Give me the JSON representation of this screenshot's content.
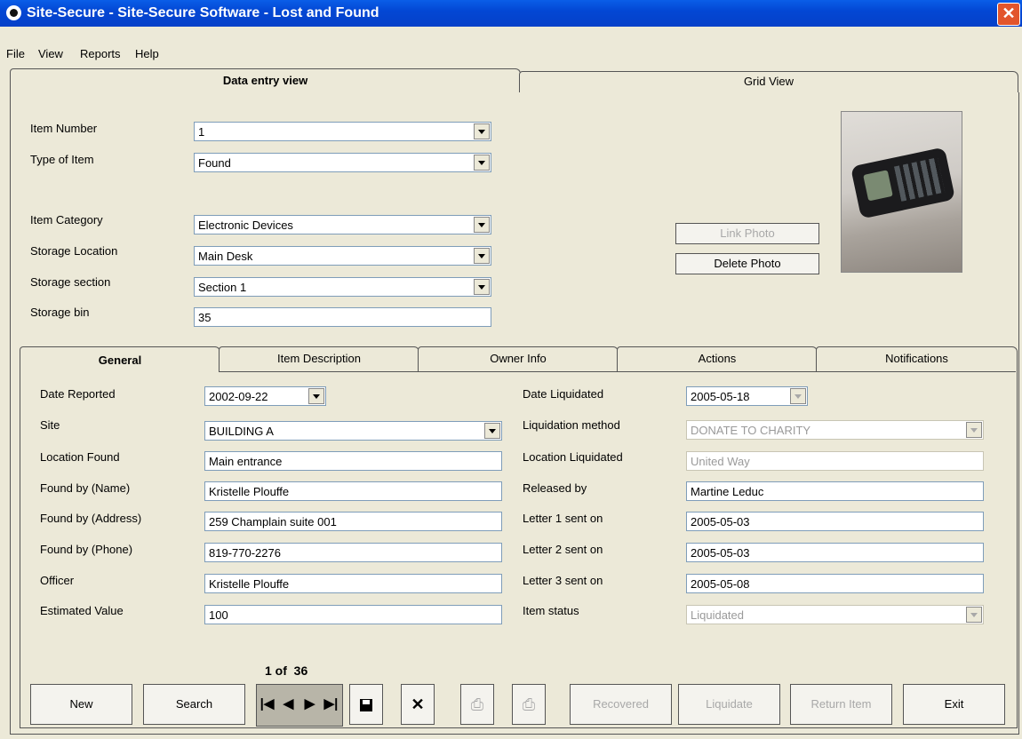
{
  "window": {
    "title": "Site-Secure - Site-Secure Software - Lost and Found",
    "close": "✕"
  },
  "menu": [
    "File",
    "View",
    "Reports",
    "Help"
  ],
  "main_tabs": [
    {
      "label": "Data entry view",
      "active": true
    },
    {
      "label": "Grid View",
      "active": false
    }
  ],
  "top_form": {
    "item_number": {
      "label": "Item Number",
      "value": "1"
    },
    "type_of_item": {
      "label": "Type of Item",
      "value": "Found"
    },
    "item_category": {
      "label": "Item Category",
      "value": "Electronic Devices"
    },
    "storage_location": {
      "label": "Storage Location",
      "value": "Main Desk"
    },
    "storage_section": {
      "label": "Storage section",
      "value": "Section 1"
    },
    "storage_bin": {
      "label": "Storage bin",
      "value": "35"
    }
  },
  "photo": {
    "link_label": "Link Photo",
    "delete_label": "Delete Photo"
  },
  "sub_tabs": [
    {
      "label": "General",
      "active": true
    },
    {
      "label": "Item Description",
      "active": false
    },
    {
      "label": "Owner Info",
      "active": false
    },
    {
      "label": "Actions",
      "active": false
    },
    {
      "label": "Notifications",
      "active": false
    }
  ],
  "general": {
    "date_reported": {
      "label": "Date Reported",
      "value": "2002-09-22"
    },
    "site": {
      "label": "Site",
      "value": "BUILDING A"
    },
    "location_found": {
      "label": "Location Found",
      "value": "Main entrance"
    },
    "found_by_name": {
      "label": "Found by (Name)",
      "value": "Kristelle Plouffe"
    },
    "found_by_address": {
      "label": "Found by (Address)",
      "value": "259 Champlain suite 001"
    },
    "found_by_phone": {
      "label": "Found by (Phone)",
      "value": "819-770-2276"
    },
    "officer": {
      "label": "Officer",
      "value": "Kristelle Plouffe"
    },
    "estimated_value": {
      "label": "Estimated Value",
      "value": "100"
    },
    "date_liquidated": {
      "label": "Date Liquidated",
      "value": "2005-05-18"
    },
    "liquidation_method": {
      "label": "Liquidation method",
      "value": "DONATE TO CHARITY"
    },
    "location_liquidated": {
      "label": "Location Liquidated",
      "value": "United Way"
    },
    "released_by": {
      "label": "Released by",
      "value": "Martine Leduc"
    },
    "letter1": {
      "label": "Letter 1 sent on",
      "value": "2005-05-03"
    },
    "letter2": {
      "label": "Letter 2 sent on",
      "value": "2005-05-03"
    },
    "letter3": {
      "label": "Letter 3 sent on",
      "value": "2005-05-08"
    },
    "item_status": {
      "label": "Item status",
      "value": "Liquidated"
    }
  },
  "record_counter": "1 of  36",
  "buttons": {
    "new": "New",
    "search": "Search",
    "recovered": "Recovered",
    "liquidate": "Liquidate",
    "return_item": "Return Item",
    "exit": "Exit"
  }
}
